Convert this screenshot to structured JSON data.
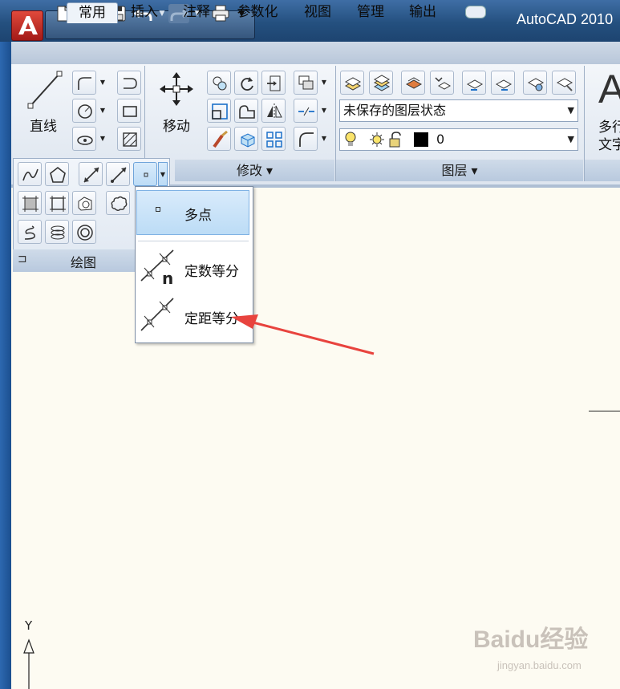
{
  "window": {
    "title": "AutoCAD 2010"
  },
  "tabs": [
    "常用",
    "插入",
    "注释",
    "参数化",
    "视图",
    "管理",
    "输出"
  ],
  "ribbon": {
    "draw": {
      "line_label": "直线",
      "panel_title": "绘图"
    },
    "modify": {
      "move_label": "移动",
      "panel_title": "修改 ▾"
    },
    "layers": {
      "state_combo": "未保存的图层状态",
      "layer_combo": "0",
      "panel_title": "图层 ▾"
    },
    "annotation": {
      "mtext_label_line1": "多行",
      "mtext_label_line2": "文字"
    }
  },
  "point_menu": {
    "items": [
      "多点",
      "定数等分",
      "定距等分"
    ],
    "highlighted": "多点"
  },
  "canvas": {
    "ucs_y_label": "Y"
  },
  "watermark": {
    "brand": "Baidu经验",
    "url": "jingyan.baidu.com"
  },
  "colors": {
    "accent_red": "#e8433e",
    "canvas_bg": "#fdfbf2",
    "highlight": "#bcdcf6"
  }
}
